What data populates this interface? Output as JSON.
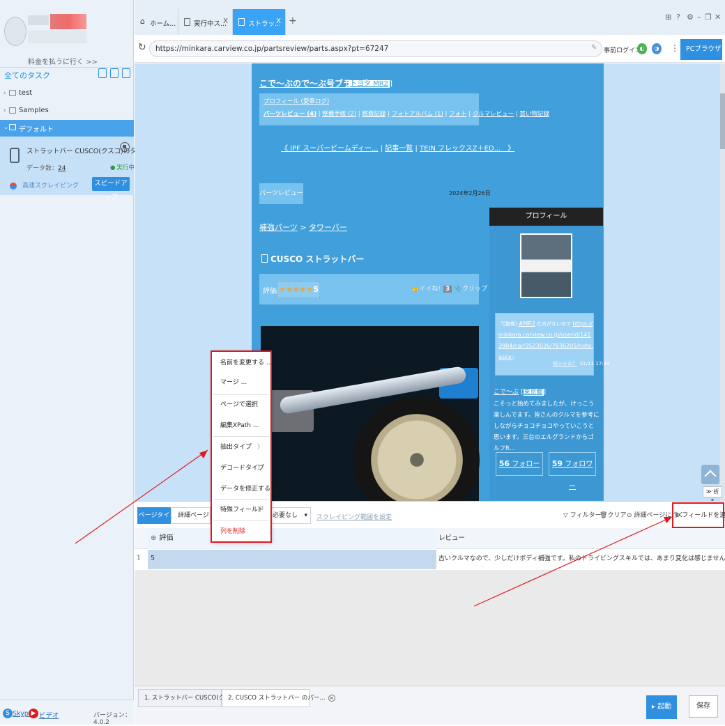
{
  "sidebar": {
    "pay_link": "料金を払うに行く >>",
    "all_tasks": "全てのタスク",
    "tree": [
      {
        "label": "test"
      },
      {
        "label": "Samples"
      },
      {
        "label": "デフォルト"
      }
    ],
    "task": {
      "title": "ストラットバー CUSCO(クスコ)のタワー...",
      "count_label": "データ数：",
      "count": "24",
      "status": "実行中",
      "mode": "高速スクレイピング",
      "speed_button": "スピードアップ"
    },
    "footer": {
      "skype": "Skype",
      "video": "ビデオ",
      "version": "バージョン：4.0.2"
    }
  },
  "tabs": [
    {
      "label": "ホーム..."
    },
    {
      "label": "実行中ス..."
    },
    {
      "label": "ストラッ..."
    }
  ],
  "tab_close": "X",
  "tab_new": "+",
  "address": {
    "url": "https://minkara.carview.co.jp/partsreview/parts.aspx?pt=67247",
    "pre_login": "事前ログイン",
    "browser_mode": "PCブラウザ"
  },
  "web": {
    "blog_title": "こで～ぶので～ぶ号ブラッグ",
    "blog_car": "トヨタ MR2",
    "nav_row1": "プロフィール (愛車ログ)",
    "nav_row2": [
      "パーツレビュー (4)",
      "整備手帳 (2)",
      "燃費記録",
      "フォトアルバム (1)",
      "フォト",
      "クルマレビュー",
      "買い物記録"
    ],
    "prev": "《 IPF スーパービームディー...",
    "list": "記事一覧",
    "next": "TEIN フレックスZ＋ED...　》",
    "section_button": "パーツレビュー",
    "date": "2024年2月26日",
    "breadcrumb_a": "補強パーツ",
    "breadcrumb_sep": " > ",
    "breadcrumb_b": "タワーバー",
    "product_title": "CUSCO ストラットバー",
    "rating_label": "評価：",
    "stars": "★★★★★",
    "rating_value": "5",
    "iine": "イイね!",
    "iine_count": "3",
    "clip": "クリップ",
    "profile": {
      "header": "プロフィール",
      "bubble_text": "「[整備] ",
      "bubble_link1": "#MR2",
      "bubble_text2": " 仕方がないので ",
      "bubble_link2": "https://minkara.carview.co.jp/userid/1413904/car/3523026/7836205/note.aspx",
      "bubble_end": "」",
      "bubble_user": "何シテル？",
      "bubble_time": "01/11 17:34",
      "name": "こで～ぶ",
      "name_link": "東京都",
      "desc": "こそっと始めてみましたが、けっこう楽しんでます。皆さんのクルマを参考にしながらチョコチョコやっていこうと思います。三台のエルグランドからゴルフR...",
      "follow": "56",
      "follow_label": "フォロー",
      "follower": "59",
      "follower_label": "フォロワー"
    },
    "fold": "≫ 折る"
  },
  "panel": {
    "page_type": "ページタイプ",
    "page_type_value": "詳細ページ",
    "load_value": "必要なし",
    "scope": "スクレイピング範囲を設定",
    "filter": "フィルター",
    "clear": "クリア",
    "goto_detail": "詳細ページに行く",
    "add_field": "フィールドを追加",
    "columns": [
      "評価",
      "レビュー"
    ],
    "rows": [
      {
        "num": "1",
        "rating": "5",
        "review": "古いクルマなので、少しだけボディ補強です。私のドライビングスキルでは、あまり変化は感じません。ほぼほぼ見た目重視で良いんじゃないでしょうか。"
      }
    ]
  },
  "context_menu": [
    {
      "label": "名前を変更する ..."
    },
    {
      "label": "マージ ..."
    },
    {
      "label": "ページで選択"
    },
    {
      "label": "編集XPath ..."
    },
    {
      "label": "抽出タイプ"
    },
    {
      "label": "デコードタイプ"
    },
    {
      "label": "データを修正する ..."
    },
    {
      "label": "特殊フィールド"
    },
    {
      "label": "列を削除"
    }
  ],
  "bottom_tabs": [
    {
      "label": "1. ストラットバー CUSCO(クスコ..."
    },
    {
      "label": "2. CUSCO ストラットバー のパー..."
    }
  ],
  "buttons": {
    "start": "起動",
    "save": "保存"
  },
  "colors": {
    "accent": "#2f8fe0",
    "annotation": "#e0191f",
    "page": "#41a0dc"
  }
}
